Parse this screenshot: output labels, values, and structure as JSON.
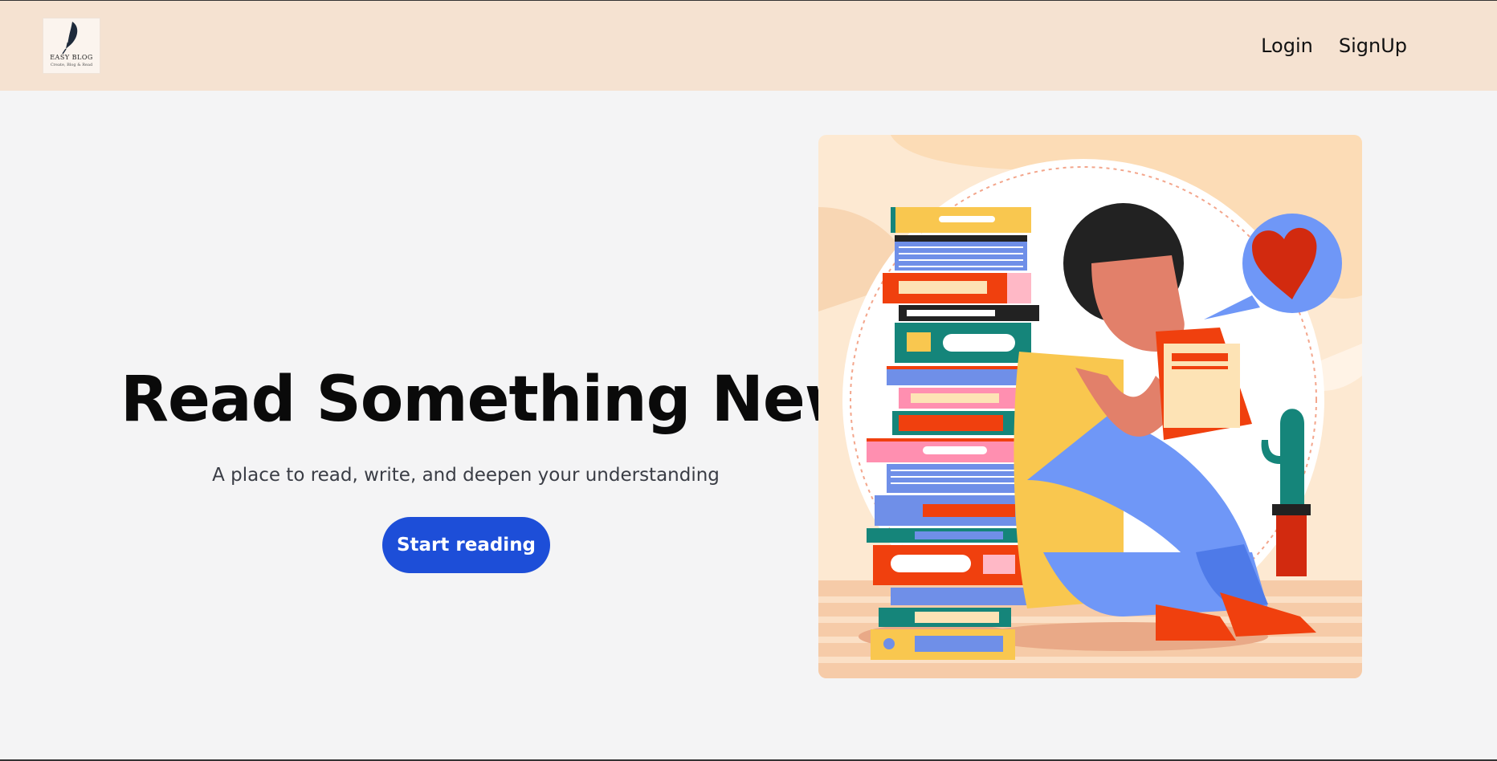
{
  "brand": {
    "logo_text": "EASY BLOG",
    "logo_tagline": "Create, Blog & Read"
  },
  "nav": {
    "login_label": "Login",
    "signup_label": "SignUp"
  },
  "hero": {
    "title": "Read Something New",
    "subtitle": "A place to read, write, and deepen your understanding",
    "cta_label": "Start reading"
  },
  "colors": {
    "navbar_bg": "#f5e2d1",
    "page_bg": "#f4f4f5",
    "cta_bg": "#1d4ed8",
    "illustration_bg": "#fde9d2"
  }
}
